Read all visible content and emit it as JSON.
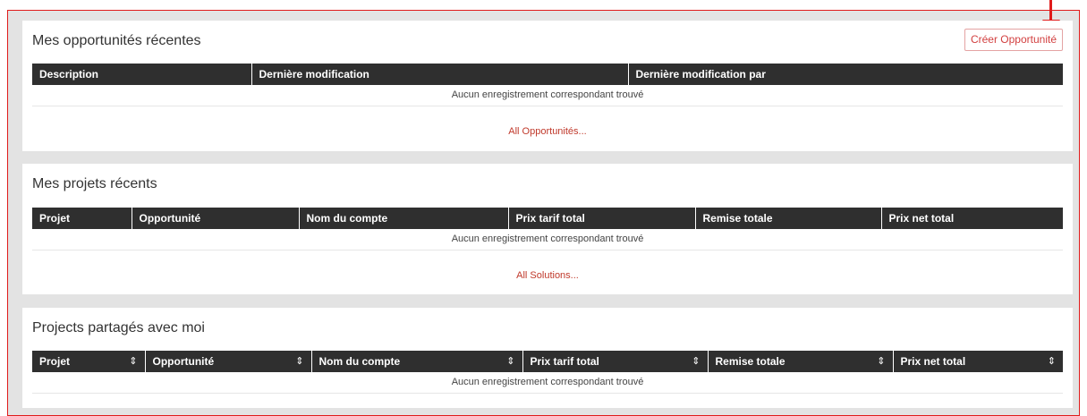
{
  "opportunities": {
    "title": "Mes opportunités récentes",
    "create_button": "Créer Opportunité",
    "columns": [
      "Description",
      "Dernière modification",
      "Dernière modification par"
    ],
    "empty_message": "Aucun enregistrement correspondant trouvé",
    "all_link": "All Opportunités..."
  },
  "projects": {
    "title": "Mes projets récents",
    "columns": [
      "Projet",
      "Opportunité",
      "Nom du compte",
      "Prix tarif total",
      "Remise totale",
      "Prix net total"
    ],
    "empty_message": "Aucun enregistrement correspondant trouvé",
    "all_link": "All Solutions..."
  },
  "shared": {
    "title": "Projects partagés avec moi",
    "columns": [
      "Projet",
      "Opportunité",
      "Nom du compte",
      "Prix tarif total",
      "Remise totale",
      "Prix net total"
    ],
    "sort_icon": "sort-icon",
    "empty_message": "Aucun enregistrement correspondant trouvé"
  },
  "annotation": {
    "color": "#e01b1b"
  }
}
